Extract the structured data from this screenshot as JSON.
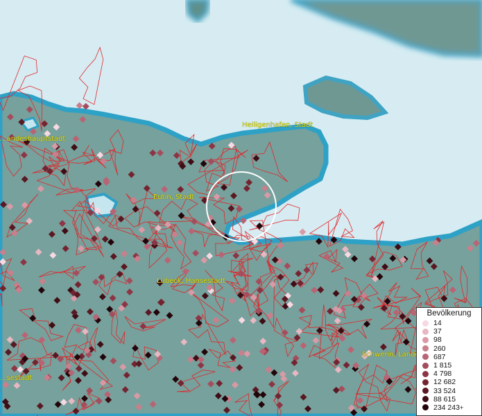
{
  "places": [
    {
      "name": "Heiligenhafen, Stadt"
    },
    {
      "name": "Eutin, Stadt"
    },
    {
      "name": "Lübeck, Hansestadt"
    },
    {
      "name": "Schwerin, Landes..."
    },
    {
      "name": "...andeshauptstadt"
    },
    {
      "name": "...sestadt"
    }
  ],
  "legend": {
    "title": "Bevölkerung",
    "entries": [
      {
        "label": "14",
        "color": "#f6d9e3"
      },
      {
        "label": "37",
        "color": "#e7b7c2"
      },
      {
        "label": "98",
        "color": "#d99aa6"
      },
      {
        "label": "260",
        "color": "#c97f8c"
      },
      {
        "label": "687",
        "color": "#b96474"
      },
      {
        "label": "1 815",
        "color": "#a44d5c"
      },
      {
        "label": "4 798",
        "color": "#8c3545"
      },
      {
        "label": "12 682",
        "color": "#742431"
      },
      {
        "label": "33 524",
        "color": "#5a1822"
      },
      {
        "label": "88 615",
        "color": "#3f0d15"
      },
      {
        "label": "234 243",
        "color": "#22050a",
        "suffix": "+"
      }
    ]
  },
  "colors": {
    "water": "#d6ecf2",
    "land": "#77a19c",
    "boundary": "#e0262a",
    "label": "#e6e600"
  }
}
